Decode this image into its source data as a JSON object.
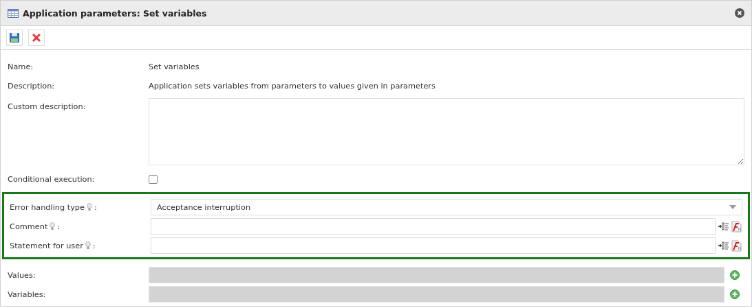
{
  "window": {
    "title": "Application parameters: Set variables"
  },
  "toolbar": [
    {
      "kind": "save"
    },
    {
      "kind": "cancel"
    }
  ],
  "fields": [
    {
      "kind": "text",
      "label": "Name:",
      "value": "Set variables"
    },
    {
      "kind": "text",
      "label": "Description:",
      "value": "Application sets variables from parameters to values given in parameters"
    },
    {
      "kind": "textarea",
      "label": "Custom description:"
    },
    {
      "kind": "checkbox",
      "label": "Conditional execution:",
      "checked": false
    }
  ],
  "highlighted_fields": [
    {
      "kind": "select",
      "label": "Error handling type",
      "hint": true,
      "suffix": ":",
      "value": "Acceptance interruption"
    },
    {
      "kind": "input",
      "label": "Comment",
      "hint": true,
      "suffix": ":"
    },
    {
      "kind": "input",
      "label": "Statement for user",
      "hint": true,
      "suffix": ":"
    }
  ],
  "list_fields": [
    {
      "kind": "list",
      "label": "Values:"
    },
    {
      "kind": "list",
      "label": "Variables:"
    }
  ]
}
